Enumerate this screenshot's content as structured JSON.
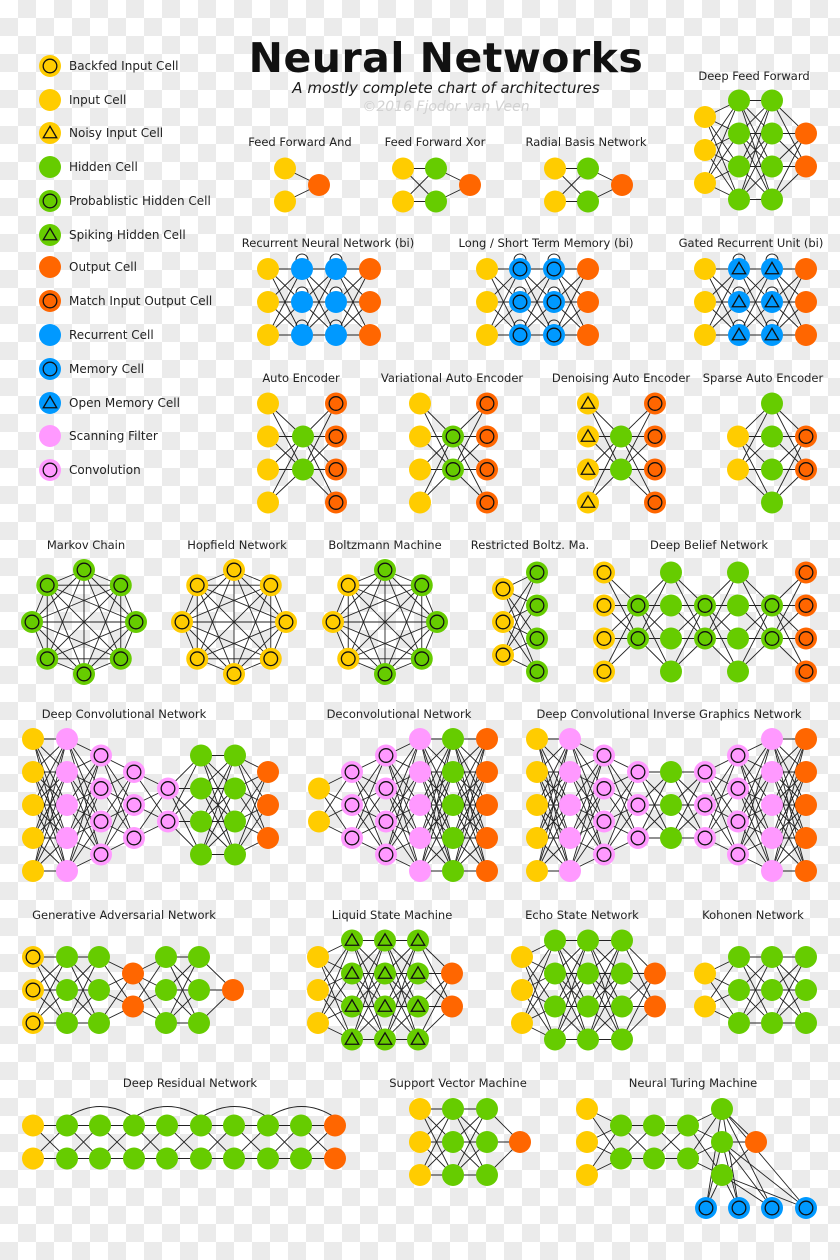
{
  "header": {
    "title": "Neural Networks",
    "subtitle": "A mostly complete chart of architectures",
    "copyright": "©2016 Fjodor van Veen"
  },
  "colors": {
    "input": "#ffcc00",
    "hidden": "#66cc00",
    "output": "#ff6600",
    "recurrent": "#0099ff",
    "scan": "#ff99ff",
    "edge": "#222222"
  },
  "legend": [
    {
      "label": "Backfed Input Cell",
      "type": "input",
      "mark": "ring"
    },
    {
      "label": "Input Cell",
      "type": "input",
      "mark": "none"
    },
    {
      "label": "Noisy Input Cell",
      "type": "input",
      "mark": "tri"
    },
    {
      "label": "Hidden Cell",
      "type": "hidden",
      "mark": "none"
    },
    {
      "label": "Probablistic Hidden Cell",
      "type": "hidden",
      "mark": "ring"
    },
    {
      "label": "Spiking Hidden Cell",
      "type": "hidden",
      "mark": "tri"
    },
    {
      "label": "Output Cell",
      "type": "output",
      "mark": "none"
    },
    {
      "label": "Match Input Output Cell",
      "type": "output",
      "mark": "ring"
    },
    {
      "label": "Recurrent Cell",
      "type": "recurrent",
      "mark": "none"
    },
    {
      "label": "Memory Cell",
      "type": "recurrent",
      "mark": "ring"
    },
    {
      "label": "Open Memory Cell",
      "type": "recurrent",
      "mark": "tri"
    },
    {
      "label": "Scanning Filter",
      "type": "scan",
      "mark": "none"
    },
    {
      "label": "Convolution",
      "type": "scan",
      "mark": "ring"
    }
  ],
  "networks": [
    {
      "name": "Feed Forward And",
      "layers": [
        {
          "type": "input",
          "n": 2
        },
        {
          "type": "output",
          "n": 1
        }
      ]
    },
    {
      "name": "Feed Forward Xor",
      "layers": [
        {
          "type": "input",
          "n": 2
        },
        {
          "type": "hidden",
          "n": 2
        },
        {
          "type": "output",
          "n": 1
        }
      ]
    },
    {
      "name": "Radial Basis Network",
      "layers": [
        {
          "type": "input",
          "n": 2
        },
        {
          "type": "hidden",
          "n": 2
        },
        {
          "type": "output",
          "n": 1
        }
      ]
    },
    {
      "name": "Deep Feed Forward",
      "layers": [
        {
          "type": "input",
          "n": 3
        },
        {
          "type": "hidden",
          "n": 4
        },
        {
          "type": "hidden",
          "n": 4
        },
        {
          "type": "output",
          "n": 2
        }
      ]
    },
    {
      "name": "Recurrent Neural Network (bi)",
      "layers": [
        {
          "type": "input",
          "n": 3
        },
        {
          "type": "recurrent",
          "n": 3,
          "loop": true
        },
        {
          "type": "recurrent",
          "n": 3,
          "loop": true
        },
        {
          "type": "output",
          "n": 3
        }
      ]
    },
    {
      "name": "Long / Short Term Memory (bi)",
      "layers": [
        {
          "type": "input",
          "n": 3
        },
        {
          "type": "recurrent",
          "mark": "ring",
          "n": 3,
          "loop": true
        },
        {
          "type": "recurrent",
          "mark": "ring",
          "n": 3,
          "loop": true
        },
        {
          "type": "output",
          "n": 3
        }
      ]
    },
    {
      "name": "Gated Recurrent Unit (bi)",
      "layers": [
        {
          "type": "input",
          "n": 3
        },
        {
          "type": "recurrent",
          "mark": "tri",
          "n": 3,
          "loop": true
        },
        {
          "type": "recurrent",
          "mark": "tri",
          "n": 3,
          "loop": true
        },
        {
          "type": "output",
          "n": 3
        }
      ]
    },
    {
      "name": "Auto Encoder",
      "layers": [
        {
          "type": "input",
          "n": 4
        },
        {
          "type": "hidden",
          "n": 2
        },
        {
          "type": "output",
          "mark": "ring",
          "n": 4
        }
      ]
    },
    {
      "name": "Variational Auto Encoder",
      "layers": [
        {
          "type": "input",
          "n": 4
        },
        {
          "type": "hidden",
          "mark": "ring",
          "n": 2
        },
        {
          "type": "output",
          "mark": "ring",
          "n": 4
        }
      ]
    },
    {
      "name": "Denoising Auto Encoder",
      "layers": [
        {
          "type": "input",
          "mark": "tri",
          "n": 4
        },
        {
          "type": "hidden",
          "n": 2
        },
        {
          "type": "output",
          "mark": "ring",
          "n": 4
        }
      ]
    },
    {
      "name": "Sparse Auto Encoder",
      "layers": [
        {
          "type": "input",
          "n": 2
        },
        {
          "type": "hidden",
          "n": 4
        },
        {
          "type": "output",
          "mark": "ring",
          "n": 2
        }
      ]
    },
    {
      "name": "Markov Chain",
      "ring": [
        {
          "type": "hidden",
          "mark": "ring"
        },
        {
          "type": "hidden",
          "mark": "ring"
        },
        {
          "type": "hidden",
          "mark": "ring"
        },
        {
          "type": "hidden",
          "mark": "ring"
        },
        {
          "type": "hidden",
          "mark": "ring"
        },
        {
          "type": "hidden",
          "mark": "ring"
        },
        {
          "type": "hidden",
          "mark": "ring"
        },
        {
          "type": "hidden",
          "mark": "ring"
        }
      ]
    },
    {
      "name": "Hopfield Network",
      "ring": [
        {
          "type": "input",
          "mark": "ring"
        },
        {
          "type": "input",
          "mark": "ring"
        },
        {
          "type": "input",
          "mark": "ring"
        },
        {
          "type": "input",
          "mark": "ring"
        },
        {
          "type": "input",
          "mark": "ring"
        },
        {
          "type": "input",
          "mark": "ring"
        },
        {
          "type": "input",
          "mark": "ring"
        },
        {
          "type": "input",
          "mark": "ring"
        }
      ]
    },
    {
      "name": "Boltzmann Machine",
      "ring": [
        {
          "type": "hidden",
          "mark": "ring"
        },
        {
          "type": "hidden",
          "mark": "ring"
        },
        {
          "type": "hidden",
          "mark": "ring"
        },
        {
          "type": "hidden",
          "mark": "ring"
        },
        {
          "type": "hidden",
          "mark": "ring"
        },
        {
          "type": "input",
          "mark": "ring"
        },
        {
          "type": "input",
          "mark": "ring"
        },
        {
          "type": "input",
          "mark": "ring"
        }
      ]
    },
    {
      "name": "Restricted Boltz. Ma.",
      "layers": [
        {
          "type": "input",
          "mark": "ring",
          "n": 3
        },
        {
          "type": "hidden",
          "mark": "ring",
          "n": 4
        }
      ]
    },
    {
      "name": "Deep Belief Network",
      "layers": [
        {
          "type": "input",
          "mark": "ring",
          "n": 4
        },
        {
          "type": "hidden",
          "mark": "ring",
          "n": 2
        },
        {
          "type": "hidden",
          "n": 4
        },
        {
          "type": "hidden",
          "mark": "ring",
          "n": 2
        },
        {
          "type": "hidden",
          "n": 4
        },
        {
          "type": "hidden",
          "mark": "ring",
          "n": 2
        },
        {
          "type": "output",
          "mark": "ring",
          "n": 4
        }
      ]
    },
    {
      "name": "Deep Convolutional Network",
      "layers": [
        {
          "type": "input",
          "n": 5
        },
        {
          "type": "scan",
          "n": 5
        },
        {
          "type": "scan",
          "mark": "ring",
          "n": 4
        },
        {
          "type": "scan",
          "mark": "ring",
          "n": 3
        },
        {
          "type": "scan",
          "mark": "ring",
          "n": 2
        },
        {
          "type": "hidden",
          "n": 4
        },
        {
          "type": "hidden",
          "n": 4
        },
        {
          "type": "output",
          "n": 3
        }
      ]
    },
    {
      "name": "Deconvolutional Network",
      "layers": [
        {
          "type": "input",
          "n": 2
        },
        {
          "type": "scan",
          "mark": "ring",
          "n": 3
        },
        {
          "type": "scan",
          "mark": "ring",
          "n": 4
        },
        {
          "type": "scan",
          "n": 5
        },
        {
          "type": "hidden",
          "n": 5
        },
        {
          "type": "output",
          "n": 5
        }
      ]
    },
    {
      "name": "Deep Convolutional Inverse Graphics Network",
      "layers": [
        {
          "type": "input",
          "n": 5
        },
        {
          "type": "scan",
          "n": 5
        },
        {
          "type": "scan",
          "mark": "ring",
          "n": 4
        },
        {
          "type": "scan",
          "mark": "ring",
          "n": 3
        },
        {
          "type": "hidden",
          "n": 3
        },
        {
          "type": "scan",
          "mark": "ring",
          "n": 3
        },
        {
          "type": "scan",
          "mark": "ring",
          "n": 4
        },
        {
          "type": "scan",
          "n": 5
        },
        {
          "type": "output",
          "n": 5
        }
      ]
    },
    {
      "name": "Generative Adversarial Network",
      "layers": [
        {
          "type": "input",
          "mark": "ring",
          "n": 3
        },
        {
          "type": "hidden",
          "n": 3
        },
        {
          "type": "hidden",
          "n": 3
        },
        {
          "type": "output",
          "n": 2
        },
        {
          "type": "hidden",
          "n": 3
        },
        {
          "type": "hidden",
          "n": 3
        },
        {
          "type": "output",
          "n": 1
        }
      ]
    },
    {
      "name": "Liquid State Machine",
      "layers": [
        {
          "type": "input",
          "n": 3
        },
        {
          "type": "hidden",
          "mark": "tri",
          "n": 4
        },
        {
          "type": "hidden",
          "mark": "tri",
          "n": 4
        },
        {
          "type": "hidden",
          "mark": "tri",
          "n": 4
        },
        {
          "type": "output",
          "n": 2
        }
      ]
    },
    {
      "name": "Echo State Network",
      "layers": [
        {
          "type": "input",
          "n": 3
        },
        {
          "type": "hidden",
          "n": 4
        },
        {
          "type": "hidden",
          "n": 4
        },
        {
          "type": "hidden",
          "n": 4
        },
        {
          "type": "output",
          "n": 2
        }
      ]
    },
    {
      "name": "Kohonen Network",
      "layers": [
        {
          "type": "input",
          "n": 2
        },
        {
          "type": "hidden",
          "n": 3
        },
        {
          "type": "hidden",
          "n": 3
        },
        {
          "type": "hidden",
          "n": 3
        }
      ]
    },
    {
      "name": "Deep Residual Network",
      "layers": [
        {
          "type": "input",
          "n": 2
        },
        {
          "type": "hidden",
          "n": 2
        },
        {
          "type": "hidden",
          "n": 2
        },
        {
          "type": "hidden",
          "n": 2
        },
        {
          "type": "hidden",
          "n": 2
        },
        {
          "type": "hidden",
          "n": 2
        },
        {
          "type": "hidden",
          "n": 2
        },
        {
          "type": "hidden",
          "n": 2
        },
        {
          "type": "hidden",
          "n": 2
        },
        {
          "type": "output",
          "n": 2
        }
      ]
    },
    {
      "name": "Support Vector Machine",
      "layers": [
        {
          "type": "input",
          "n": 3
        },
        {
          "type": "hidden",
          "n": 3
        },
        {
          "type": "hidden",
          "n": 3
        },
        {
          "type": "output",
          "n": 1
        }
      ]
    },
    {
      "name": "Neural Turing Machine",
      "layers": [
        {
          "type": "input",
          "n": 3
        },
        {
          "type": "hidden",
          "n": 2
        },
        {
          "type": "hidden",
          "n": 2
        },
        {
          "type": "hidden",
          "n": 2
        },
        {
          "type": "hidden",
          "n": 3
        },
        {
          "type": "output",
          "n": 1
        }
      ],
      "memory": {
        "type": "recurrent",
        "mark": "ring",
        "n": 4
      }
    }
  ]
}
